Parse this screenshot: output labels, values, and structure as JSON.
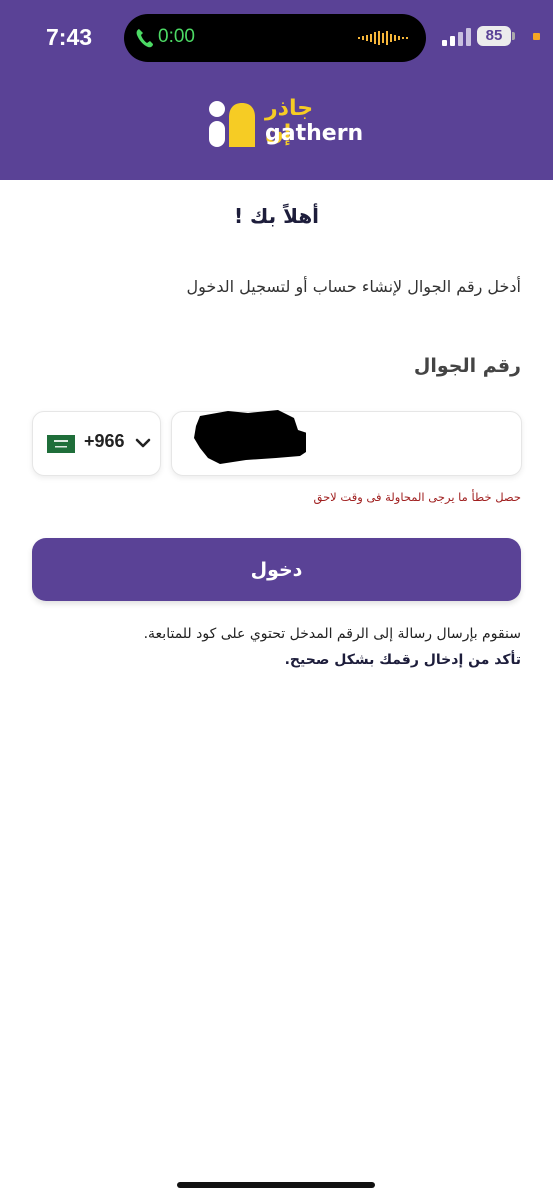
{
  "status_bar": {
    "time": "7:43",
    "call_time": "0:00",
    "battery": "85"
  },
  "brand": {
    "arabic": "جاذر إن",
    "english": "gathern",
    "colors": {
      "header_bg": "#5a4296",
      "logo_yellow": "#f6cc24"
    }
  },
  "login": {
    "title": "أهلاً بك !",
    "subtitle": "أدخل رقم الجوال لإنشاء حساب أو لتسجيل الدخول",
    "phone_label": "رقم الجوال",
    "country_code": "+966",
    "country_flag_icon": "saudi-flag-icon",
    "error": "حصل خطأ ما يرجى المحاولة فى وقت لاحق",
    "submit_label": "دخول",
    "note_line1": "سنقوم بإرسال رسالة إلى الرقم المدخل تحتوي على كود للمتابعة.",
    "note_line2": "تأكد من إدخال رقمك بشكل صحيح."
  }
}
